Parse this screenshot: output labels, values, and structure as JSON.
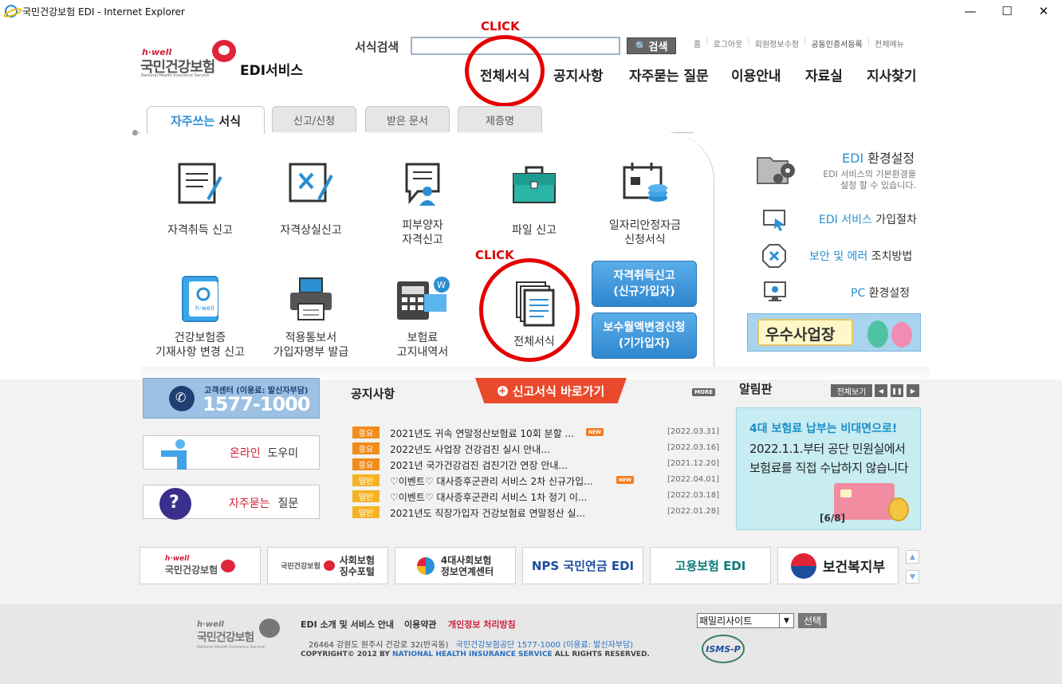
{
  "window": {
    "title": "국민건강보험 EDI - Internet Explorer",
    "minimize": "—",
    "maximize": "☐",
    "close": "✕"
  },
  "header": {
    "logo_hwell": "h·well",
    "logo_main": "국민건강보험",
    "logo_sub": "National Health Insurance Service",
    "service_name": "EDI서비스",
    "search_label": "서식검색",
    "search_value": "",
    "search_button": "검색",
    "util_links": [
      "홈",
      "로그아웃",
      "회원정보수정",
      "공동인증서등록",
      "전체메뉴"
    ],
    "gnb": [
      "전체서식",
      "공지사항",
      "자주묻는 질문",
      "이용안내",
      "자료실",
      "지사찾기"
    ]
  },
  "annotations": {
    "click_label": "CLICK"
  },
  "tabs": {
    "active_highlight": "자주쓰는",
    "active_rest": " 서식",
    "others": [
      "신고/신청",
      "받은 문서",
      "제증명"
    ]
  },
  "quick_forms": [
    {
      "line1": "자격취득 신고",
      "line2": ""
    },
    {
      "line1": "자격상실신고",
      "line2": ""
    },
    {
      "line1": "피부양자",
      "line2": "자격신고"
    },
    {
      "line1": "파일 신고",
      "line2": ""
    },
    {
      "line1": "일자리안정자금",
      "line2": "신청서식"
    },
    {
      "line1": "건강보험증",
      "line2": "기재사항 변경 신고"
    },
    {
      "line1": "적용통보서",
      "line2": "가입자명부 발급"
    },
    {
      "line1": "보험료",
      "line2": "고지내역서"
    },
    {
      "line1": "전체서식",
      "line2": ""
    }
  ],
  "blue_buttons": [
    {
      "line1": "자격취득신고",
      "line2": "(신규가입자)"
    },
    {
      "line1": "보수월액변경신청",
      "line2": "(기가입자)"
    }
  ],
  "right_menu": {
    "env_title_blue": "EDI",
    "env_title_rest": " 환경설정",
    "env_desc1": "EDI 서비스의 기본환경을",
    "env_desc2": "설정 할 수 있습니다.",
    "items": [
      {
        "blue": "EDI 서비스",
        "rest": " 가입절차"
      },
      {
        "blue": "보안 및 에러",
        "rest": " 조치방법"
      },
      {
        "blue": "PC",
        "rest": " 환경설정"
      }
    ],
    "best_banner": "우수사업장"
  },
  "customer_center": {
    "label": "고객센터 (이용료: 발신자부담)",
    "phone": "1577-1000"
  },
  "side_buttons": [
    {
      "red": "온라인",
      "rest": " 도우미"
    },
    {
      "red": "자주묻는",
      "rest": " 질문"
    }
  ],
  "notice": {
    "title": "공지사항",
    "shortcut": "신고서식 바로가기",
    "more": "MORE",
    "new_label": "NEW",
    "rows": [
      {
        "badge": "중요",
        "text": "2021년도 귀속 연말정산보험료 10회 분할 ...",
        "new": true,
        "date": "[2022.03.31]"
      },
      {
        "badge": "중요",
        "text": "2022년도 사업장 건강검진 실시 안내...",
        "new": false,
        "date": "[2022.03.16]"
      },
      {
        "badge": "중요",
        "text": "2021년 국가건강검진 검진기간 연장 안내...",
        "new": false,
        "date": "[2021.12.20]"
      },
      {
        "badge": "일반",
        "text": "♡이벤트♡ 대사증후군관리 서비스 2차 신규가입...",
        "new": true,
        "date": "[2022.04.01]"
      },
      {
        "badge": "일반",
        "text": "♡이벤트♡ 대사증후군관리 서비스 1차 정기 이...",
        "new": false,
        "date": "[2022.03.18]"
      },
      {
        "badge": "일반",
        "text": "2021년도 직장가입자 건강보험료 연말정산 실...",
        "new": false,
        "date": "[2022.01.28]"
      }
    ]
  },
  "alarm": {
    "title": "알림판",
    "view_all": "전체보기",
    "prev": "◀",
    "pause": "❚❚",
    "next": "▶",
    "line1": "4대 보험료 납부는 비대면으로!",
    "line2": "2022.1.1.부터 공단 민원실에서",
    "line3": "보험료를 직접 수납하지 않습니다",
    "page": "[6/8]"
  },
  "partners": [
    {
      "name": "국민건강보험",
      "sub": ""
    },
    {
      "name": "사회보험",
      "sub": "징수포털"
    },
    {
      "name": "4대사회보험",
      "sub": "정보연계센터"
    },
    {
      "name": "NPS 국민연금 EDI",
      "sub": ""
    },
    {
      "name": "고용보험 EDI",
      "sub": ""
    },
    {
      "name": "보건복지부",
      "sub": ""
    }
  ],
  "footer": {
    "links": [
      "EDI 소개 및 서비스 안내",
      "이용약관",
      "개인정보 처리방침"
    ],
    "address": "26464 강원도 원주시 건강로 32(반곡동)",
    "org_phone": "국민건강보험공단 1577-1000 (이용료: 발신자부담)",
    "copyright_prefix": "COPYRIGHT© 2012 BY ",
    "copyright_org": "NATIONAL HEALTH INSURANCE SERVICE",
    "copyright_suffix": " ALL RIGHTS RESERVED.",
    "family_site": "패밀리사이트",
    "select_button": "선택",
    "isms": "ISMS-P"
  }
}
